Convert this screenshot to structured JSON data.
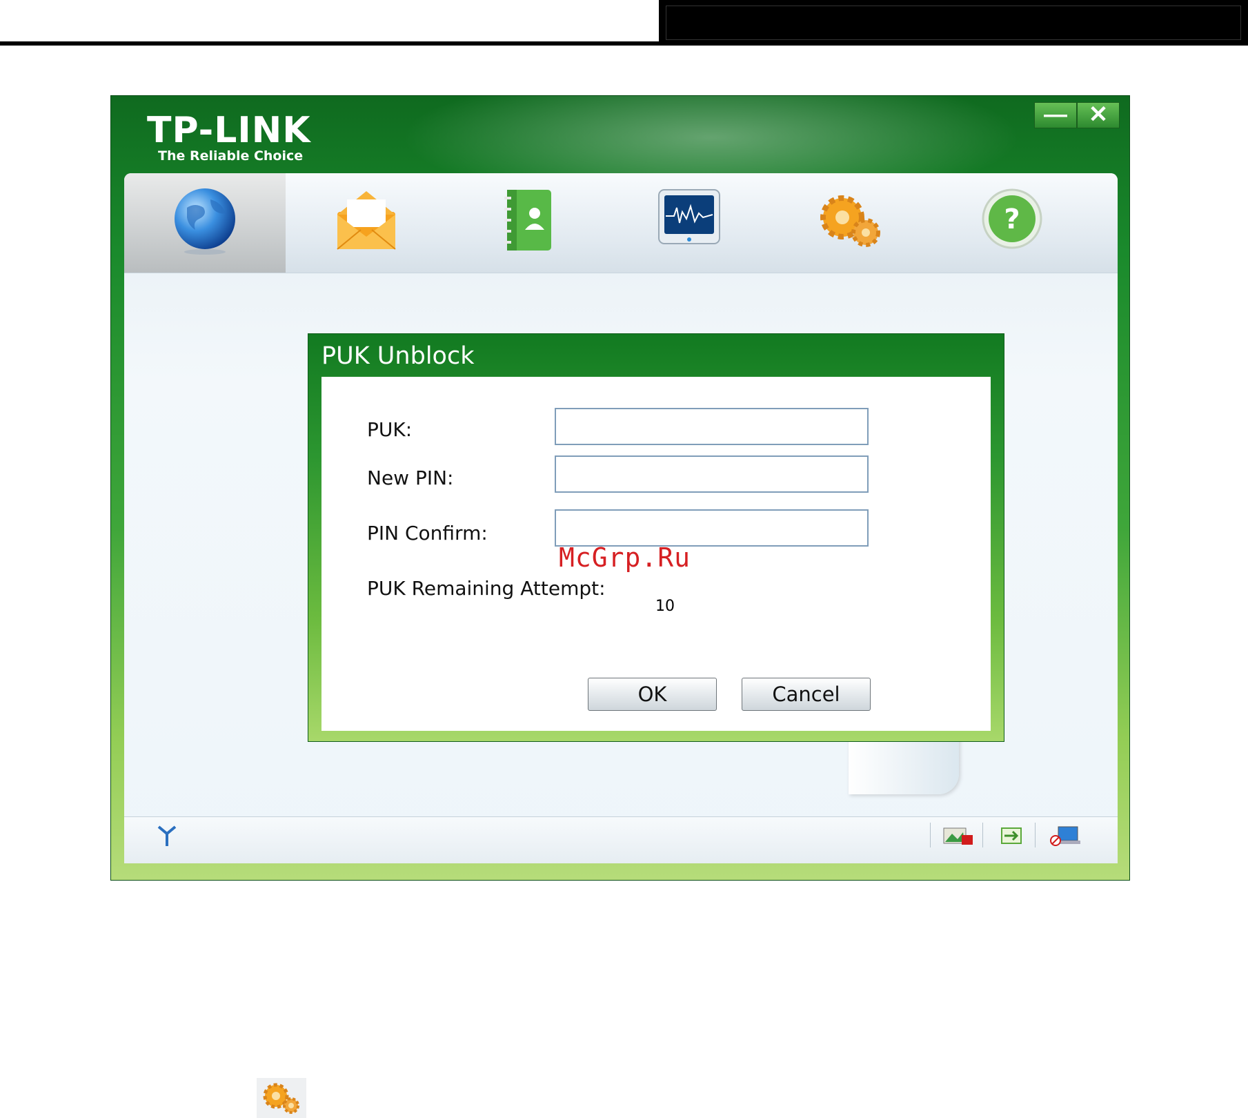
{
  "app": {
    "logo_text": "TP-LINK",
    "tagline": "The Reliable Choice",
    "window_controls": {
      "minimize_icon": "minimize-icon",
      "close_icon": "close-icon"
    },
    "toolbar": [
      {
        "id": "internet",
        "icon": "globe-icon",
        "active": true
      },
      {
        "id": "sms",
        "icon": "envelope-icon",
        "active": false
      },
      {
        "id": "phonebook",
        "icon": "address-book-icon",
        "active": false
      },
      {
        "id": "statistics",
        "icon": "monitor-pulse-icon",
        "active": false
      },
      {
        "id": "settings",
        "icon": "gears-icon",
        "active": false
      },
      {
        "id": "help",
        "icon": "help-icon",
        "active": false
      }
    ],
    "status_bar_icons": [
      "signal-antenna-icon",
      "sim-card-lock-icon",
      "connection-indicator-icon",
      "network-disconnected-icon"
    ]
  },
  "dialog": {
    "title": "PUK Unblock",
    "fields": [
      {
        "label": "PUK:",
        "value": ""
      },
      {
        "label": "New PIN:",
        "value": ""
      },
      {
        "label": "PIN Confirm:",
        "value": ""
      }
    ],
    "remaining_label": "PUK Remaining Attempt:",
    "remaining_value": "10",
    "ok_label": "OK",
    "cancel_label": "Cancel"
  },
  "watermark": "McGrp.Ru",
  "colors": {
    "brand_green": "#1a8a2c",
    "accent_light_green": "#a8d86a",
    "watermark_red": "#d62023"
  }
}
